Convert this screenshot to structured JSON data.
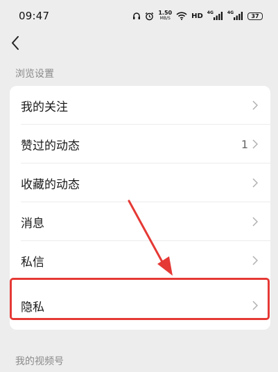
{
  "status_bar": {
    "time": "09:47",
    "speed_value": "1.50",
    "speed_unit": "MB/S",
    "hd_label": "HD",
    "sig1_label": "4G",
    "sig2_label": "4G",
    "battery_level": "37",
    "icons": [
      "headphones-icon",
      "alarm-icon",
      "wifi-icon",
      "signal-icon",
      "signal-icon",
      "battery-icon"
    ]
  },
  "nav": {
    "back_icon": "chevron-left-icon"
  },
  "sections": {
    "browse_title": "浏览设置",
    "video_title": "我的视频号"
  },
  "menu": {
    "items": [
      {
        "label": "我的关注",
        "count": ""
      },
      {
        "label": "赞过的动态",
        "count": "1"
      },
      {
        "label": "收藏的动态",
        "count": ""
      },
      {
        "label": "消息",
        "count": ""
      },
      {
        "label": "私信",
        "count": ""
      },
      {
        "label": "隐私",
        "count": ""
      }
    ]
  },
  "annotation": {
    "highlight_color": "#e53935",
    "highlighted_item": "隐私"
  }
}
